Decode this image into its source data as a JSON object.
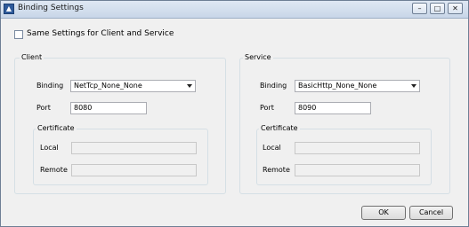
{
  "window": {
    "title": "Binding Settings"
  },
  "controls": {
    "minimize": "–",
    "maximize": "□",
    "close": "✕"
  },
  "same_settings": {
    "label": "Same Settings for Client and Service",
    "checked": false
  },
  "client": {
    "legend": "Client",
    "binding_label": "Binding",
    "binding_value": "NetTcp_None_None",
    "port_label": "Port",
    "port_value": "8080",
    "certificate": {
      "legend": "Certificate",
      "local_label": "Local",
      "local_value": "",
      "remote_label": "Remote",
      "remote_value": ""
    }
  },
  "service": {
    "legend": "Service",
    "binding_label": "Binding",
    "binding_value": "BasicHttp_None_None",
    "port_label": "Port",
    "port_value": "8090",
    "certificate": {
      "legend": "Certificate",
      "local_label": "Local",
      "local_value": "",
      "remote_label": "Remote",
      "remote_value": ""
    }
  },
  "buttons": {
    "ok": "OK",
    "cancel": "Cancel"
  }
}
